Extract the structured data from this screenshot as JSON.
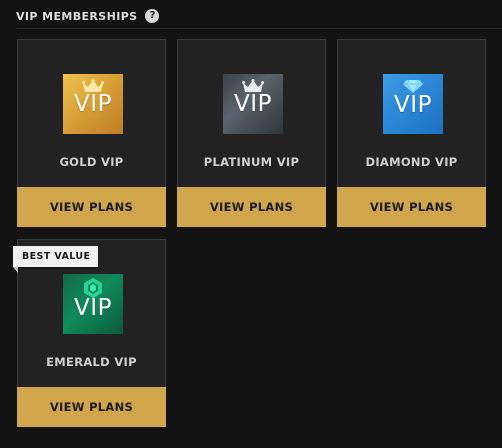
{
  "header": {
    "title": "VIP MEMBERSHIPS",
    "help_icon": "question-mark-icon"
  },
  "cards": [
    {
      "name": "GOLD VIP",
      "logo_text": "VIP",
      "icon": "crown-icon",
      "button_label": "VIEW PLANS",
      "colors": [
        "#f0c24f",
        "#c07d27"
      ]
    },
    {
      "name": "PLATINUM VIP",
      "logo_text": "VIP",
      "icon": "crown-icon",
      "button_label": "VIEW PLANS",
      "colors": [
        "#5a636b",
        "#2f353b"
      ]
    },
    {
      "name": "DIAMOND VIP",
      "logo_text": "VIP",
      "icon": "diamond-icon",
      "button_label": "VIEW PLANS",
      "colors": [
        "#3f9be4",
        "#1f6fc2"
      ]
    },
    {
      "name": "EMERALD VIP",
      "logo_text": "VIP",
      "icon": "emerald-gem-icon",
      "button_label": "VIEW PLANS",
      "badge": "BEST VALUE",
      "colors": [
        "#0f8a5a",
        "#0b5a3d"
      ]
    }
  ],
  "accent_color": "#d1a54a",
  "background_color": "#131313"
}
